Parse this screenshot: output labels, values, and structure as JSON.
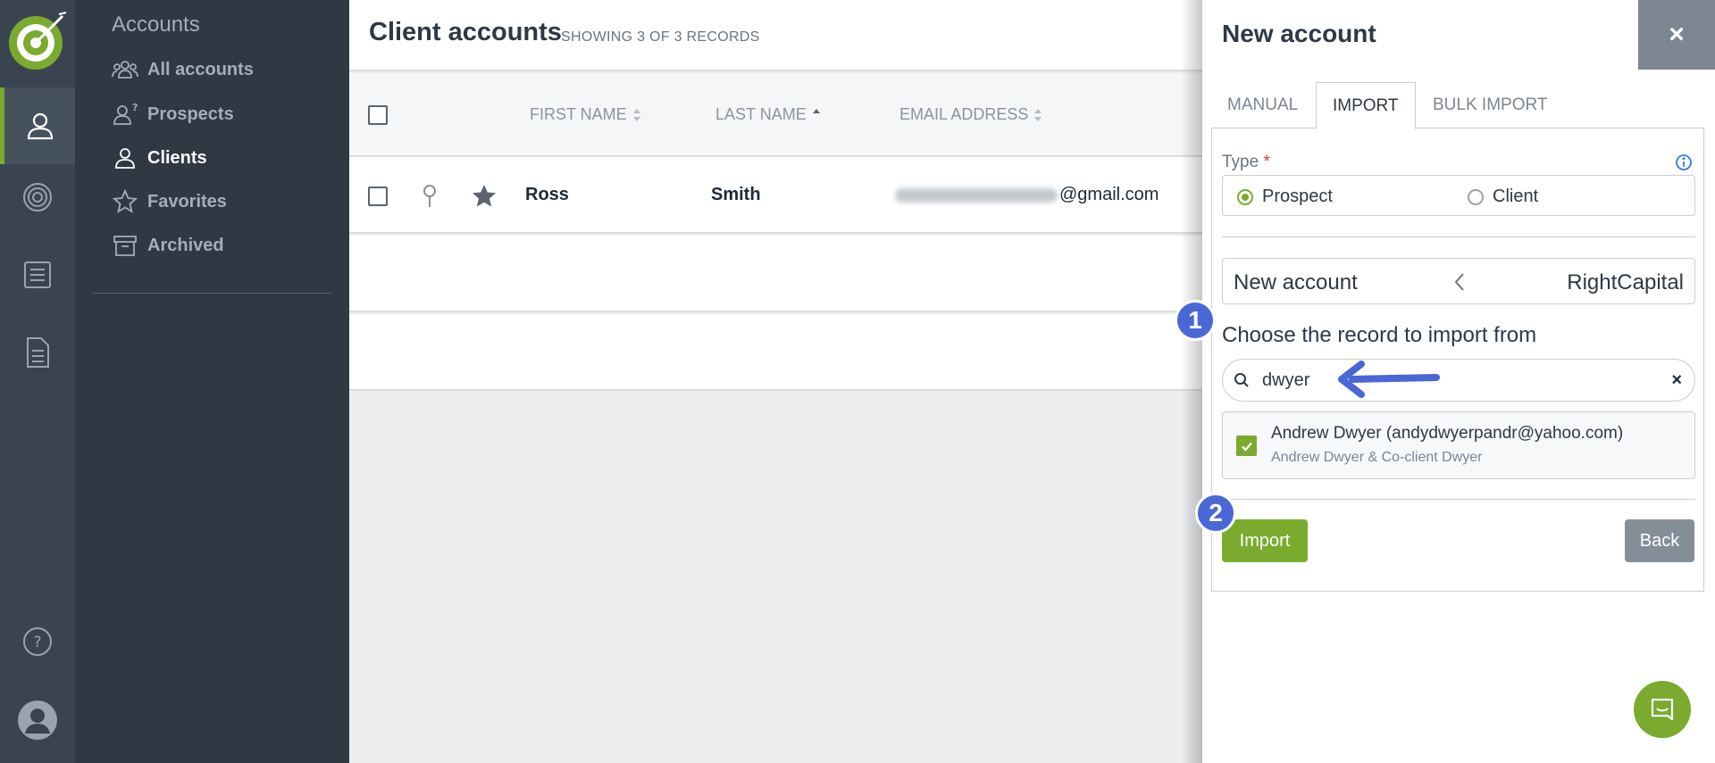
{
  "sidebar": {
    "title": "Accounts",
    "items": [
      {
        "label": "All accounts",
        "icon": "users-icon"
      },
      {
        "label": "Prospects",
        "icon": "prospect-icon"
      },
      {
        "label": "Clients",
        "icon": "user-icon"
      },
      {
        "label": "Favorites",
        "icon": "star-icon"
      },
      {
        "label": "Archived",
        "icon": "archive-icon"
      }
    ],
    "active_item": "Clients"
  },
  "main": {
    "title": "Client accounts",
    "records_label": "SHOWING 3 OF 3 RECORDS",
    "columns": [
      "FIRST NAME",
      "LAST NAME",
      "EMAIL ADDRESS"
    ],
    "rows": [
      {
        "first_name": "Ross",
        "last_name": "Smith",
        "email_visible": "@gmail.com"
      }
    ]
  },
  "panel": {
    "title": "New account",
    "close_label": "×",
    "tabs": [
      "MANUAL",
      "IMPORT",
      "BULK IMPORT"
    ],
    "active_tab": "IMPORT",
    "type_label": "Type",
    "required_mark": "*",
    "type_options": [
      "Prospect",
      "Client"
    ],
    "type_selected": "Prospect",
    "source_left": "New account",
    "source_right": "RightCapital",
    "choose_label": "Choose the record to import from",
    "search": {
      "value": "dwyer",
      "clear": "×"
    },
    "result": {
      "title": "Andrew Dwyer (andydwyerpandr@yahoo.com)",
      "subtitle": "Andrew Dwyer & Co-client Dwyer",
      "checked": true
    },
    "import_label": "Import",
    "back_label": "Back"
  },
  "annotations": {
    "step1": "1",
    "step2": "2",
    "arrow_color": "#4a67d6"
  },
  "colors": {
    "accent": "#7aab2e",
    "rail": "#3a4450",
    "sidebar": "#2f3843",
    "badge": "#4a67d6"
  }
}
